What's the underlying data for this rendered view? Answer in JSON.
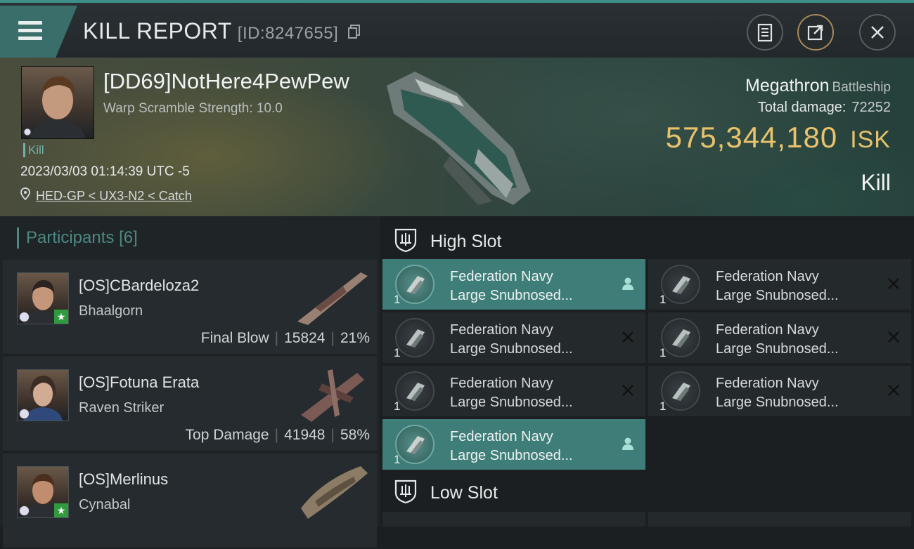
{
  "header": {
    "title": "KILL REPORT",
    "id_text": "[ID:8247655]"
  },
  "victim": {
    "name": "[DD69]NotHere4PewPew",
    "warp_scramble": "Warp Scramble Strength: 10.0",
    "tag": "Kill",
    "timestamp": "2023/03/03 01:14:39 UTC -5",
    "location": "HED-GP < UX3-N2 < Catch",
    "ship_name": "Megathron",
    "ship_class": "Battleship",
    "total_damage_label": "Total damage:",
    "total_damage": "72252",
    "isk_value": "575,344,180",
    "isk_unit": "ISK",
    "result": "Kill"
  },
  "participants": {
    "title": "Participants",
    "count": "[6]",
    "rows": [
      {
        "name": "[OS]CBardeloza2",
        "ship": "Bhaalgorn",
        "role": "Final Blow",
        "damage": "15824",
        "percent": "21%"
      },
      {
        "name": "[OS]Fotuna Erata",
        "ship": "Raven Striker",
        "role": "Top Damage",
        "damage": "41948",
        "percent": "58%"
      },
      {
        "name": "[OS]Merlinus",
        "ship": "Cynabal",
        "role": "",
        "damage": "",
        "percent": ""
      }
    ]
  },
  "fitting": {
    "high_slot_label": "High Slot",
    "low_slot_label": "Low Slot",
    "high_modules": [
      {
        "line1": "Federation Navy",
        "line2": "Large Snubnosed...",
        "qty": "1",
        "status": "person-icon"
      },
      {
        "line1": "Federation Navy",
        "line2": "Large Snubnosed...",
        "qty": "1",
        "status": "destroyed-x-icon"
      },
      {
        "line1": "Federation Navy",
        "line2": "Large Snubnosed...",
        "qty": "1",
        "status": "destroyed-x-icon"
      },
      {
        "line1": "Federation Navy",
        "line2": "Large Snubnosed...",
        "qty": "1",
        "status": "destroyed-x-icon"
      },
      {
        "line1": "Federation Navy",
        "line2": "Large Snubnosed...",
        "qty": "1",
        "status": "destroyed-x-icon"
      },
      {
        "line1": "Federation Navy",
        "line2": "Large Snubnosed...",
        "qty": "1",
        "status": "destroyed-x-icon"
      },
      {
        "line1": "Federation Navy",
        "line2": "Large Snubnosed...",
        "qty": "1",
        "status": "person-icon"
      }
    ]
  },
  "colors": {
    "accent": "#3e8f88",
    "isk": "#e9c36b",
    "highlight_row": "#3f7e78"
  }
}
